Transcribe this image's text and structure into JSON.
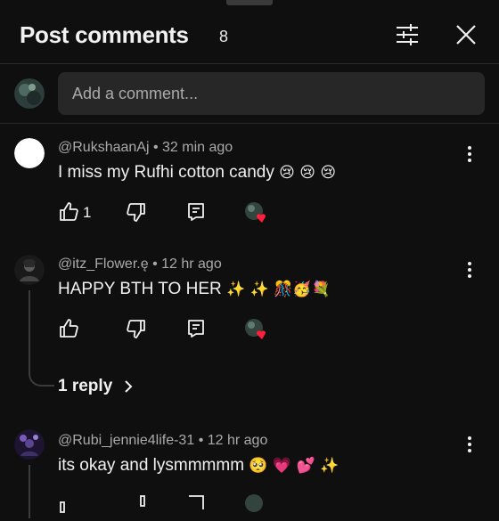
{
  "header": {
    "title": "Post comments",
    "count": "8"
  },
  "composer": {
    "placeholder": "Add a comment..."
  },
  "comments": [
    {
      "author": "@RukshaanAj",
      "time": "32 min ago",
      "text": "I miss my Rufhi cotton candy",
      "emojis": "😢 😢 😢",
      "likes": "1"
    },
    {
      "author": "@itz_Flower.ę",
      "time": "12 hr ago",
      "text": "HAPPY BTH TO HER",
      "emojis": "✨ ✨ 🎊🥳💐",
      "likes": "",
      "replies_label": "1 reply"
    },
    {
      "author": "@Rubi_jennie4life-31",
      "time": "12 hr ago",
      "text": "its okay and lysmmmmm",
      "emojis": "🥺 💗 💕 ✨",
      "likes": ""
    }
  ],
  "colors": {
    "background": "#0f0f0f",
    "heart": "#ff1f3d",
    "secondary_text": "#aaaaaa"
  },
  "icons": [
    "sort-icon",
    "close-icon",
    "thumbs-up-icon",
    "thumbs-down-icon",
    "reply-icon",
    "creator-heart-icon",
    "more-vert-icon",
    "chevron-right-icon"
  ]
}
